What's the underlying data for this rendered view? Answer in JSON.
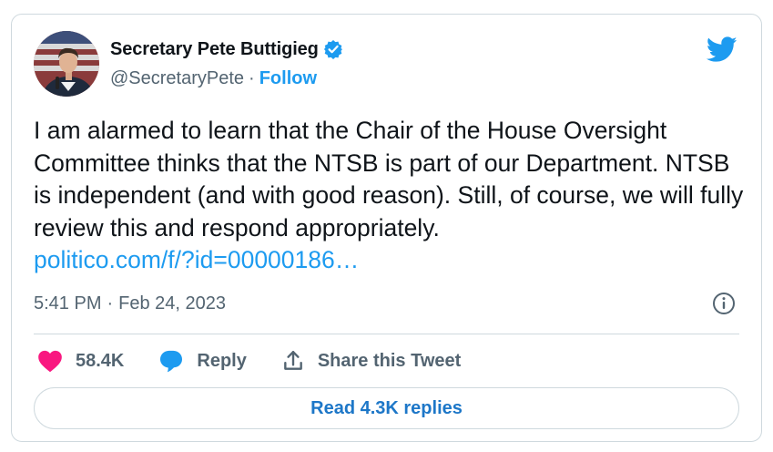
{
  "author": {
    "display_name": "Secretary Pete Buttigieg",
    "handle": "@SecretaryPete",
    "separator": "·",
    "follow_label": "Follow",
    "verified": true
  },
  "tweet": {
    "text": "I am alarmed to learn that the Chair of the House Oversight Committee thinks that the NTSB is part of our Department. NTSB is independent (and with good reason). Still, of course, we will fully review this and respond appropriately.",
    "link_text": "politico.com/f/?id=00000186…",
    "time": "5:41 PM",
    "meta_separator": "·",
    "date": "Feb 24, 2023"
  },
  "actions": {
    "like_count": "58.4K",
    "reply_label": "Reply",
    "share_label": "Share this Tweet"
  },
  "read_replies_label": "Read 4.3K replies",
  "colors": {
    "brand_blue": "#1d9bf0",
    "like_pink": "#f91880",
    "text_primary": "#0f1419",
    "text_secondary": "#536471",
    "border": "#cfd9de"
  },
  "icons": {
    "avatar": "profile-photo",
    "verified": "verified-badge-icon",
    "logo": "twitter-bird-icon",
    "info": "info-icon",
    "like": "heart-icon",
    "reply": "speech-bubble-icon",
    "share": "share-upload-icon"
  }
}
